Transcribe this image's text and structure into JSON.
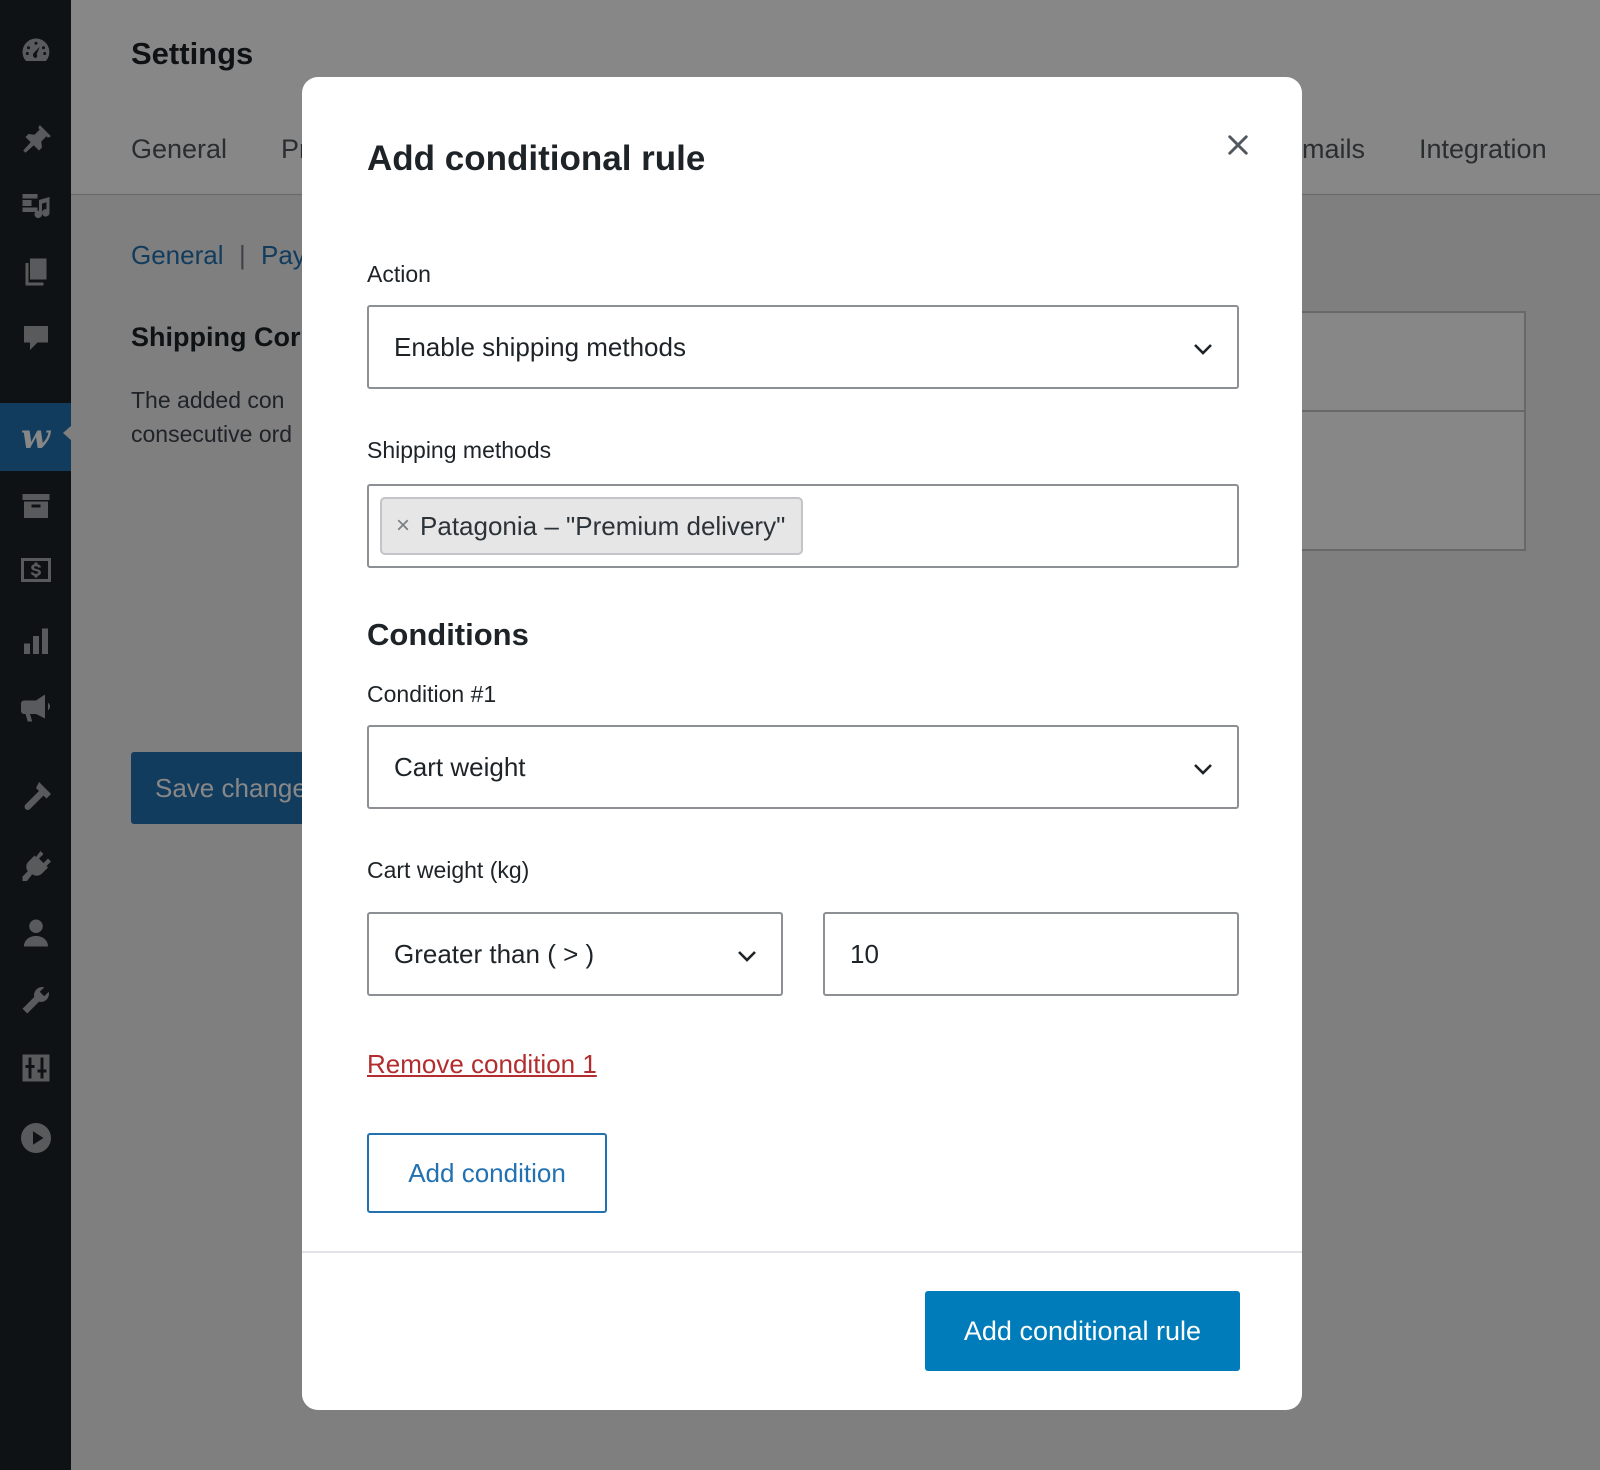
{
  "page": {
    "title": "Settings",
    "tabs": [
      "General",
      "Pr",
      "mails",
      "Integration"
    ],
    "subnav": {
      "item1": "General",
      "separator": "|",
      "item2": "Pay"
    },
    "section_heading": "Shipping Cor",
    "description_lines": [
      "The added con",
      "consecutive ord"
    ],
    "save_button": "Save changes"
  },
  "sidebar": {
    "icons": [
      "dashboard-icon",
      "pin-icon",
      "media-icon",
      "pages-icon",
      "comments-icon",
      "woocommerce-icon",
      "archive-icon",
      "payments-icon",
      "analytics-icon",
      "marketing-icon",
      "appearance-icon",
      "plugins-icon",
      "users-icon",
      "tools-icon",
      "settings-icon",
      "play-icon"
    ],
    "active": "woocommerce-icon",
    "woo_letter": "w"
  },
  "modal": {
    "title": "Add conditional rule",
    "close_symbol": "×",
    "action": {
      "label": "Action",
      "selected": "Enable shipping methods"
    },
    "shipping_methods": {
      "label": "Shipping methods",
      "chip_remove": "×",
      "chips": [
        "Patagonia – \"Premium delivery\""
      ]
    },
    "conditions_heading": "Conditions",
    "condition1": {
      "label": "Condition #1",
      "selected": "Cart weight"
    },
    "cart_weight": {
      "label": "Cart weight (kg)",
      "operator": "Greater than ( > )",
      "value": "10"
    },
    "remove_link": "Remove condition 1",
    "add_condition_button": "Add condition",
    "submit_button": "Add conditional rule"
  },
  "colors": {
    "sidebar_bg": "#1d2327",
    "accent": "#007cba",
    "link": "#2271b1",
    "danger": "#b32d2e",
    "overlay": "rgba(0,0,0,0.47)"
  }
}
